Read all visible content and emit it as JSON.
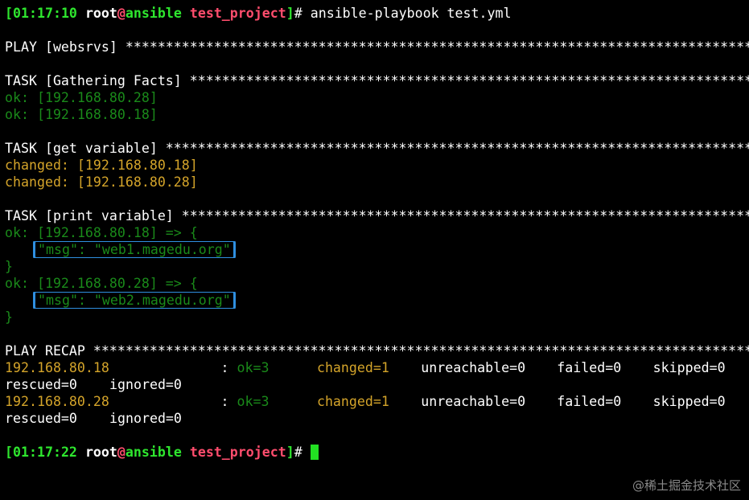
{
  "prompt1": {
    "open": "[",
    "time": "01:17:10",
    "user": "root",
    "at": "@",
    "host": "ansible",
    "dir": "test_project",
    "close": "]",
    "sym": "#",
    "command": " ansible-playbook test.yml"
  },
  "play_header": "PLAY [websrvs] *************************************************************************************",
  "task1": {
    "header": "TASK [Gathering Facts] *****************************************************************************",
    "lines": [
      "ok: [192.168.80.28]",
      "ok: [192.168.80.18]"
    ]
  },
  "task2": {
    "header": "TASK [get variable] ********************************************************************************",
    "lines": [
      "changed: [192.168.80.18]",
      "changed: [192.168.80.28]"
    ]
  },
  "task3": {
    "header": "TASK [print variable] ******************************************************************************",
    "ok1": "ok: [192.168.80.18] => {",
    "msg1": "\"msg\": \"web1.magedu.org\"",
    "close1": "}",
    "ok2": "ok: [192.168.80.28] => {",
    "msg2": "\"msg\": \"web2.magedu.org\"",
    "close2": "}"
  },
  "recap": {
    "header": "PLAY RECAP *****************************************************************************************",
    "rows": [
      {
        "host": "192.168.80.18",
        "colon": ": ",
        "ok": "ok=3",
        "changed": "changed=1",
        "unreachable": "unreachable=0",
        "failed": "failed=0",
        "skipped": "skipped=0",
        "rescued": "rescued=0",
        "ignored": "ignored=0"
      },
      {
        "host": "192.168.80.28",
        "colon": ": ",
        "ok": "ok=3",
        "changed": "changed=1",
        "unreachable": "unreachable=0",
        "failed": "failed=0",
        "skipped": "skipped=0",
        "rescued": "rescued=0",
        "ignored": "ignored=0"
      }
    ]
  },
  "prompt2": {
    "open": "[",
    "time": "01:17:22",
    "user": "root",
    "at": "@",
    "host": "ansible",
    "dir": "test_project",
    "close": "]",
    "sym": "#"
  },
  "watermark": "@稀土掘金技术社区",
  "colors": {
    "ok": "#1a8a1a",
    "changed": "#d4a42a",
    "highlight_box": "#2f8fe0",
    "prompt_time": "#2ee62e",
    "prompt_dir": "#ff4d6d"
  }
}
